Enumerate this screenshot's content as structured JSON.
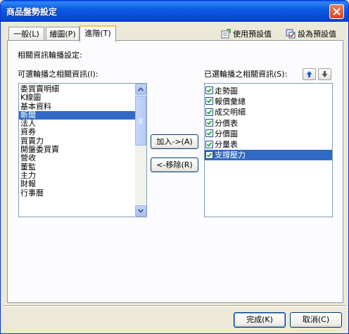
{
  "window": {
    "title": "商品盤勢設定"
  },
  "tabs": [
    {
      "label": "一般(L)",
      "key": "L"
    },
    {
      "label": "繪圖(P)",
      "key": "P"
    },
    {
      "label": "進階(T)",
      "key": "T"
    }
  ],
  "toolbar": {
    "use_default": "使用預設值",
    "set_default": "設為預設值"
  },
  "section_label": "相關資訊輪播設定:",
  "available": {
    "label": "可選輪播之相關資訊(I):",
    "items": [
      "委買賣明細",
      "K線圖",
      "基本資料",
      "新聞",
      "法人",
      "資券",
      "買賣力",
      "開盤委買賣",
      "營收",
      "董監",
      "主力",
      "財報",
      "行事曆"
    ],
    "selected_index": 3
  },
  "selected_list": {
    "label": "已選輪播之相關資訊(S):",
    "items": [
      "走勢圖",
      "報價彙總",
      "成交明細",
      "分價表",
      "分價圖",
      "分量表",
      "支撐壓力"
    ],
    "selected_index": 6
  },
  "buttons": {
    "add": "加入->(A)",
    "remove": "<-移除(R)",
    "ok": "完成(K)",
    "cancel": "取消(C)"
  },
  "colors": {
    "selection": "#316AC5",
    "titlebar": "#0548D3"
  }
}
